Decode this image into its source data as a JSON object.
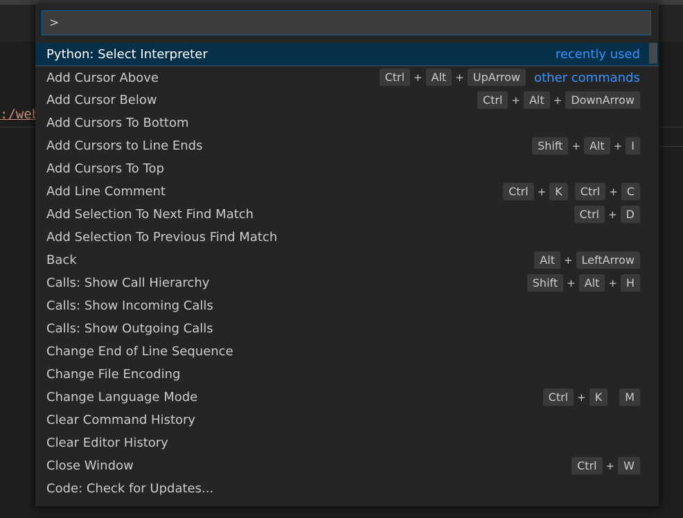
{
  "background": {
    "code_snippet": ":/web"
  },
  "palette": {
    "input_value": ">",
    "items": [
      {
        "label": "Python: Select Interpreter",
        "tag": "recently used",
        "chords": []
      },
      {
        "label": "Add Cursor Above",
        "tag": "other commands",
        "chords": [
          [
            "Ctrl",
            "Alt",
            "UpArrow"
          ]
        ]
      },
      {
        "label": "Add Cursor Below",
        "tag": "",
        "chords": [
          [
            "Ctrl",
            "Alt",
            "DownArrow"
          ]
        ]
      },
      {
        "label": "Add Cursors To Bottom",
        "tag": "",
        "chords": []
      },
      {
        "label": "Add Cursors to Line Ends",
        "tag": "",
        "chords": [
          [
            "Shift",
            "Alt",
            "I"
          ]
        ]
      },
      {
        "label": "Add Cursors To Top",
        "tag": "",
        "chords": []
      },
      {
        "label": "Add Line Comment",
        "tag": "",
        "chords": [
          [
            "Ctrl",
            "K"
          ],
          [
            "Ctrl",
            "C"
          ]
        ]
      },
      {
        "label": "Add Selection To Next Find Match",
        "tag": "",
        "chords": [
          [
            "Ctrl",
            "D"
          ]
        ]
      },
      {
        "label": "Add Selection To Previous Find Match",
        "tag": "",
        "chords": []
      },
      {
        "label": "Back",
        "tag": "",
        "chords": [
          [
            "Alt",
            "LeftArrow"
          ]
        ]
      },
      {
        "label": "Calls: Show Call Hierarchy",
        "tag": "",
        "chords": [
          [
            "Shift",
            "Alt",
            "H"
          ]
        ]
      },
      {
        "label": "Calls: Show Incoming Calls",
        "tag": "",
        "chords": []
      },
      {
        "label": "Calls: Show Outgoing Calls",
        "tag": "",
        "chords": []
      },
      {
        "label": "Change End of Line Sequence",
        "tag": "",
        "chords": []
      },
      {
        "label": "Change File Encoding",
        "tag": "",
        "chords": []
      },
      {
        "label": "Change Language Mode",
        "tag": "",
        "chords": [
          [
            "Ctrl",
            "K"
          ],
          [
            "M"
          ]
        ]
      },
      {
        "label": "Clear Command History",
        "tag": "",
        "chords": []
      },
      {
        "label": "Clear Editor History",
        "tag": "",
        "chords": []
      },
      {
        "label": "Close Window",
        "tag": "",
        "chords": [
          [
            "Ctrl",
            "W"
          ]
        ]
      },
      {
        "label": "Code: Check for Updates...",
        "tag": "",
        "chords": []
      }
    ]
  },
  "colors": {
    "accent": "#3794ff",
    "selection": "#062f4a",
    "input_border": "#0e639c"
  }
}
